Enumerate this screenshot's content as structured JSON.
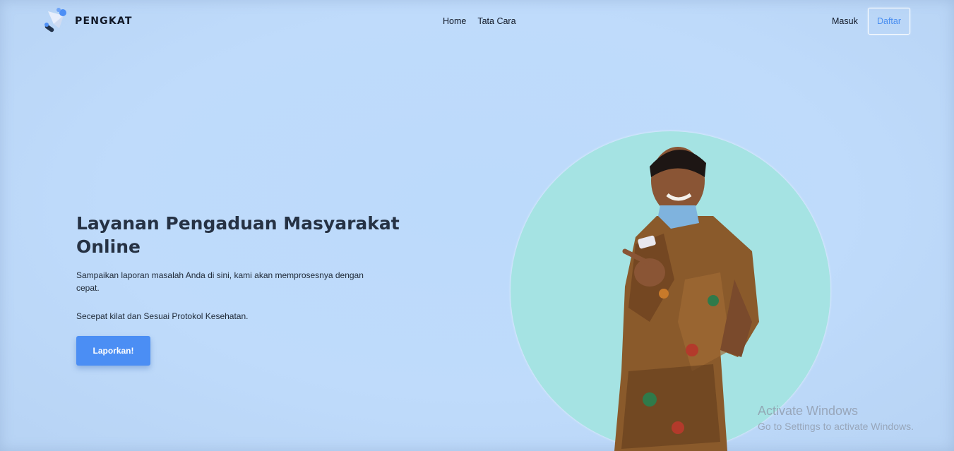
{
  "brand": {
    "name": "PENGKAT",
    "logo_icon": "paper-plane-icon"
  },
  "nav": {
    "items": [
      {
        "label": "Home"
      },
      {
        "label": "Tata Cara"
      }
    ]
  },
  "auth": {
    "login_label": "Masuk",
    "register_label": "Daftar"
  },
  "hero": {
    "title": "Layanan Pengaduan Masyarakat Online",
    "description": "Sampaikan laporan masalah Anda di sini, kami akan memprosesnya dengan cepat.",
    "subtext": "Secepat kilat dan Sesuai Protokol Kesehatan.",
    "cta_label": "Laporkan!"
  },
  "watermark": {
    "title": "Activate Windows",
    "subtitle": "Go to Settings to activate Windows."
  },
  "colors": {
    "background": "#bedcfb",
    "accent": "#4b8ef4",
    "circle": "#a5e3e3",
    "heading": "#263244"
  }
}
